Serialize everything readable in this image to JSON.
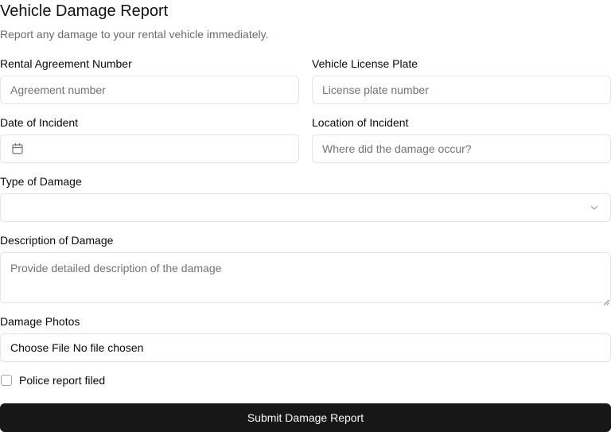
{
  "header": {
    "title": "Vehicle Damage Report",
    "subtitle": "Report any damage to your rental vehicle immediately."
  },
  "form": {
    "agreement": {
      "label": "Rental Agreement Number",
      "placeholder": "Agreement number",
      "value": ""
    },
    "plate": {
      "label": "Vehicle License Plate",
      "placeholder": "License plate number",
      "value": ""
    },
    "date": {
      "label": "Date of Incident",
      "icon": "calendar-icon",
      "value": ""
    },
    "location": {
      "label": "Location of Incident",
      "placeholder": "Where did the damage occur?",
      "value": ""
    },
    "damage_type": {
      "label": "Type of Damage",
      "selected": "",
      "icon": "chevron-down-icon"
    },
    "description": {
      "label": "Description of Damage",
      "placeholder": "Provide detailed description of the damage",
      "value": ""
    },
    "photos": {
      "label": "Damage Photos",
      "button_text": "Choose File",
      "status_text": "No file chosen"
    },
    "police_report": {
      "label": "Police report filed",
      "checked": false
    },
    "submit_label": "Submit Damage Report"
  },
  "colors": {
    "border": "#e4e4e7",
    "placeholder": "#737373",
    "subtitle": "#6b6b6b",
    "button_bg": "#171717",
    "button_text": "#fafafa"
  }
}
